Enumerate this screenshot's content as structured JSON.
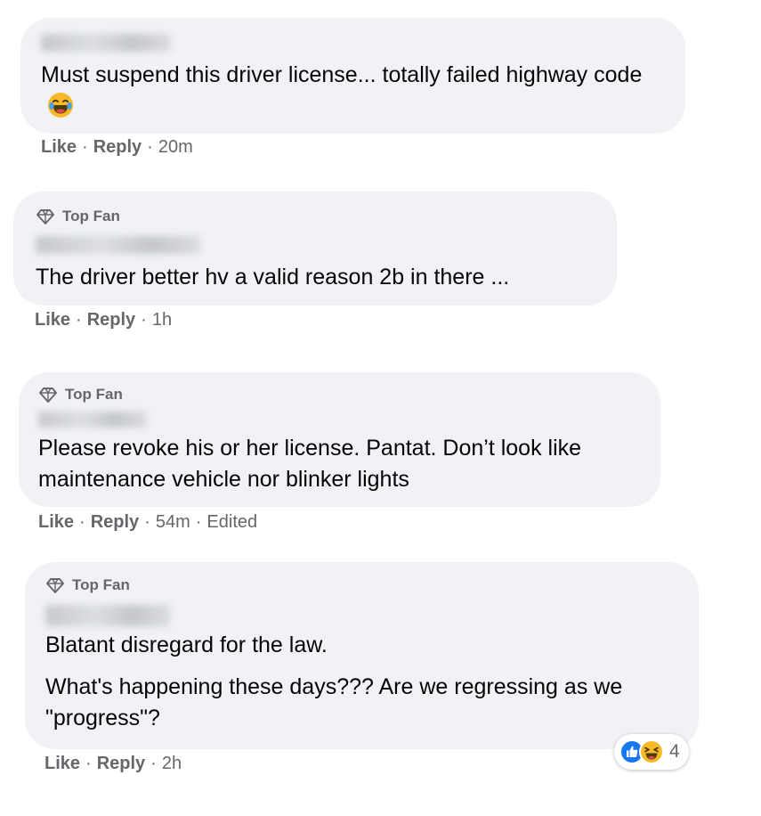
{
  "comments": [
    {
      "text": "Must suspend this driver license... totally failed highway code",
      "emoji": "laughing-emoji",
      "actions": {
        "like": "Like",
        "reply": "Reply",
        "time": "20m"
      }
    },
    {
      "badge": "Top Fan",
      "text": "The driver better hv a valid reason 2b in there ...",
      "actions": {
        "like": "Like",
        "reply": "Reply",
        "time": "1h"
      }
    },
    {
      "badge": "Top Fan",
      "text": "Please revoke his or her license. Pantat. Don’t look like maintenance vehicle nor blinker lights",
      "actions": {
        "like": "Like",
        "reply": "Reply",
        "time": "54m",
        "edited": "Edited"
      }
    },
    {
      "badge": "Top Fan",
      "paragraphs": [
        "Blatant disregard for the law.",
        "What's happening these days??? Are we regressing as we \"progress\"?"
      ],
      "actions": {
        "like": "Like",
        "reply": "Reply",
        "time": "2h"
      },
      "reactions": {
        "icons": [
          "like-reaction-icon",
          "haha-reaction-icon"
        ],
        "count": "4"
      }
    }
  ],
  "separator": "·",
  "colors": {
    "bubble": "#f0f2f5",
    "text": "#050505",
    "secondary": "#65676b",
    "like_blue": "#1877f2",
    "haha_yellow": "#f7b928"
  }
}
